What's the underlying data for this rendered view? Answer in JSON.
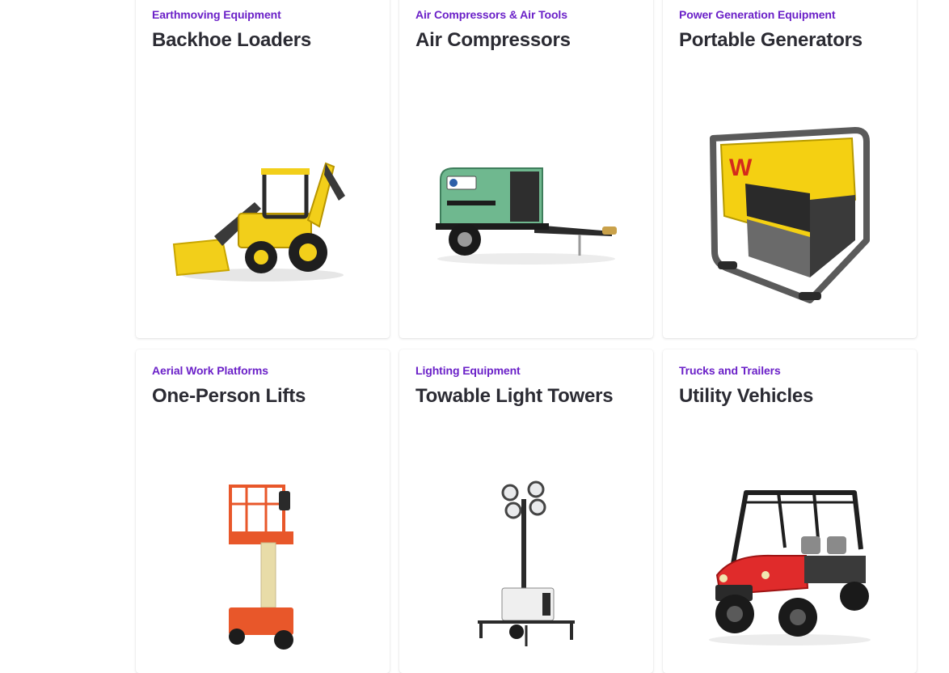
{
  "cards": [
    {
      "category": "Earthmoving Equipment",
      "title": "Backhoe Loaders",
      "icon": "backhoe-loader-image"
    },
    {
      "category": "Air Compressors & Air Tools",
      "title": "Air Compressors",
      "icon": "air-compressor-image"
    },
    {
      "category": "Power Generation Equipment",
      "title": "Portable Generators",
      "icon": "portable-generator-image"
    },
    {
      "category": "Aerial Work Platforms",
      "title": "One-Person Lifts",
      "icon": "one-person-lift-image"
    },
    {
      "category": "Lighting Equipment",
      "title": "Towable Light Towers",
      "icon": "light-tower-image"
    },
    {
      "category": "Trucks and Trailers",
      "title": "Utility Vehicles",
      "icon": "utility-vehicle-image"
    }
  ],
  "colors": {
    "category_text": "#6b21c8",
    "title_text": "#2b2b33",
    "card_background": "#ffffff"
  }
}
